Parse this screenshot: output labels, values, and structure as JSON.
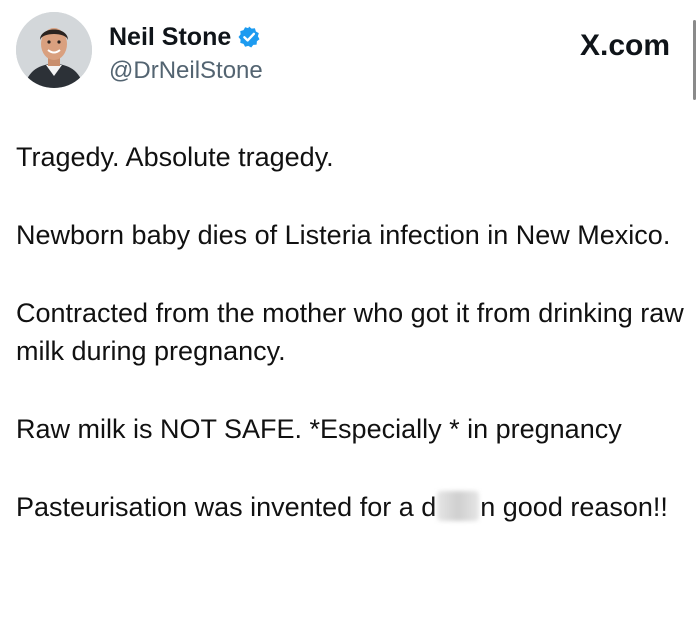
{
  "author": {
    "display_name": "Neil Stone",
    "handle": "@DrNeilStone",
    "verified": true,
    "verified_color": "#1d9bf0",
    "avatar_icon": "profile-photo"
  },
  "brand": {
    "label": "X.com"
  },
  "post": {
    "paragraphs": [
      "Tragedy. Absolute tragedy.",
      "Newborn baby dies of Listeria infection in New Mexico.",
      "Contracted from the mother who got it from drinking raw milk during pregnancy.",
      "Raw milk is NOT SAFE. *Especially * in pregnancy"
    ],
    "last_paragraph": {
      "before_blur": "Pasteurisation was invented for a d",
      "after_blur": "n good reason!!"
    }
  }
}
